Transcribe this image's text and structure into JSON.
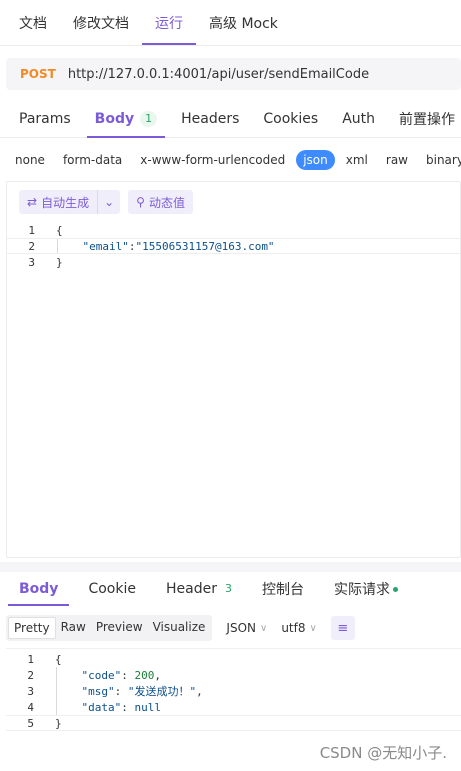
{
  "topnav": {
    "tabs": [
      "文档",
      "修改文档",
      "运行",
      "高级 Mock"
    ],
    "active_index": 2
  },
  "request": {
    "method": "POST",
    "url": "http://127.0.0.1:4001/api/user/sendEmailCode"
  },
  "request_tabs": [
    {
      "label": "Params"
    },
    {
      "label": "Body",
      "badge": "1",
      "active": true
    },
    {
      "label": "Headers"
    },
    {
      "label": "Cookies"
    },
    {
      "label": "Auth"
    },
    {
      "label": "前置操作"
    }
  ],
  "body_types": [
    "none",
    "form-data",
    "x-www-form-urlencoded",
    "json",
    "xml",
    "raw",
    "binary"
  ],
  "body_type_active": "json",
  "editor_toolbar": {
    "auto_generate": "自动生成",
    "dynamic_value": "动态值"
  },
  "request_body_lines": [
    {
      "n": "1",
      "text": "{"
    },
    {
      "n": "2",
      "key": "\"email\"",
      "sep": ":",
      "value": "\"15506531157@163.com\""
    },
    {
      "n": "3",
      "text": "}"
    }
  ],
  "response_tabs": [
    {
      "label": "Body",
      "active": true
    },
    {
      "label": "Cookie"
    },
    {
      "label": "Header",
      "badge": "3"
    },
    {
      "label": "控制台"
    },
    {
      "label": "实际请求",
      "dot": true
    }
  ],
  "response_view": {
    "modes": [
      "Pretty",
      "Raw",
      "Preview",
      "Visualize"
    ],
    "active_mode": "Pretty",
    "format": "JSON",
    "encoding": "utf8"
  },
  "response_body_lines": [
    {
      "n": "1",
      "text": "{"
    },
    {
      "n": "2",
      "key": "\"code\"",
      "sep": ": ",
      "value": "200",
      "tail": ","
    },
    {
      "n": "3",
      "key": "\"msg\"",
      "sep": ": ",
      "value": "\"发送成功！\"",
      "tail": ","
    },
    {
      "n": "4",
      "key": "\"data\"",
      "sep": ": ",
      "value": "null"
    },
    {
      "n": "5",
      "text": "}"
    }
  ],
  "watermark": "CSDN @无知小子.",
  "colors": {
    "accent": "#7c5cd6",
    "method": "#f08a24",
    "json_active": "#3d8bfd",
    "success": "#27a56a"
  }
}
